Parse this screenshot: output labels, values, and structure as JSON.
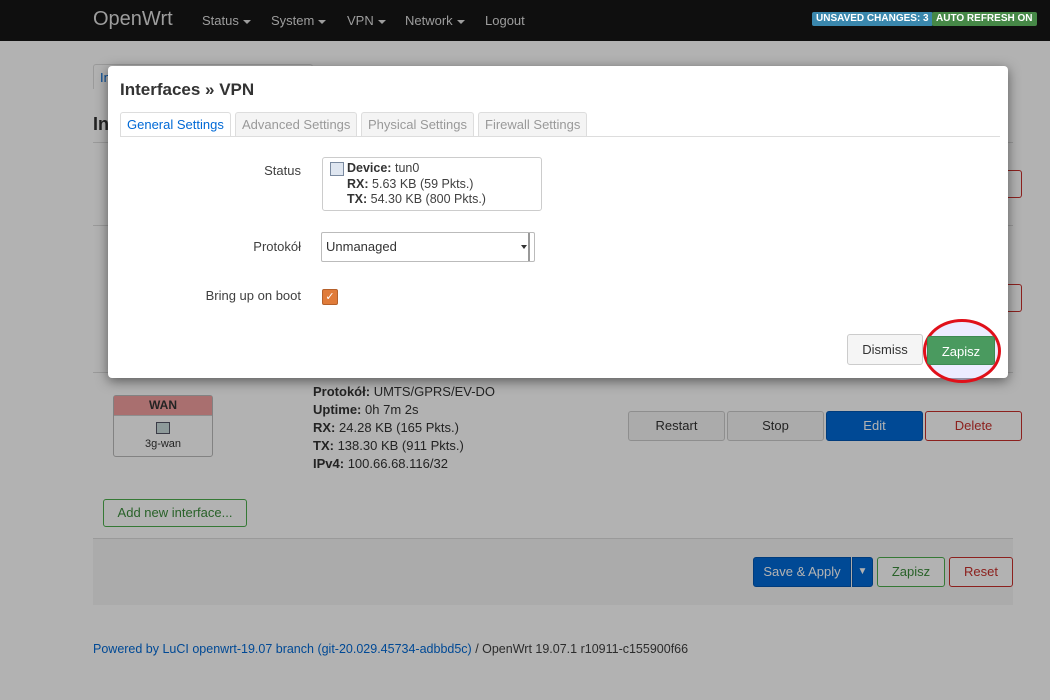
{
  "header": {
    "brand": "OpenWrt",
    "nav": [
      "Status",
      "System",
      "VPN",
      "Network",
      "Logout"
    ],
    "badge_unsaved": "UNSAVED CHANGES: 3",
    "badge_refresh": "AUTO REFRESH ON",
    "colors": {
      "unsaved": "#3a87ad",
      "refresh": "#468847"
    }
  },
  "background": {
    "tab_fragment": "In",
    "heading_fragment": "In",
    "wan": {
      "badge": "WAN",
      "name": "3g-wan",
      "protocol_label": "Protokół:",
      "protocol_value": "UMTS/GPRS/EV-DO",
      "uptime_label": "Uptime:",
      "uptime_value": "0h 7m 2s",
      "rx_label": "RX:",
      "rx_value": "24.28 KB (165 Pkts.)",
      "tx_label": "TX:",
      "tx_value": "138.30 KB (911 Pkts.)",
      "ipv4_label": "IPv4:",
      "ipv4_value": "100.66.68.116/32"
    },
    "row_buttons": {
      "restart": "Restart",
      "stop": "Stop",
      "edit": "Edit",
      "delete": "Delete"
    },
    "add_interface": "Add new interface...",
    "save_apply": "Save & Apply",
    "zapisz": "Zapisz",
    "reset": "Reset",
    "footer_link": "Powered by LuCI openwrt-19.07 branch (git-20.029.45734-adbbd5c)",
    "footer_text": " / OpenWrt 19.07.1 r10911-c155900f66"
  },
  "modal": {
    "title": "Interfaces » VPN",
    "tabs": [
      "General Settings",
      "Advanced Settings",
      "Physical Settings",
      "Firewall Settings"
    ],
    "status_label": "Status",
    "device_label": "Device:",
    "device_value": "tun0",
    "rx_label": "RX:",
    "rx_value": "5.63 KB (59 Pkts.)",
    "tx_label": "TX:",
    "tx_value": "54.30 KB (800 Pkts.)",
    "protocol_label": "Protokół",
    "protocol_value": "Unmanaged",
    "boot_label": "Bring up on boot",
    "boot_checked": true,
    "dismiss": "Dismiss",
    "save": "Zapisz"
  }
}
